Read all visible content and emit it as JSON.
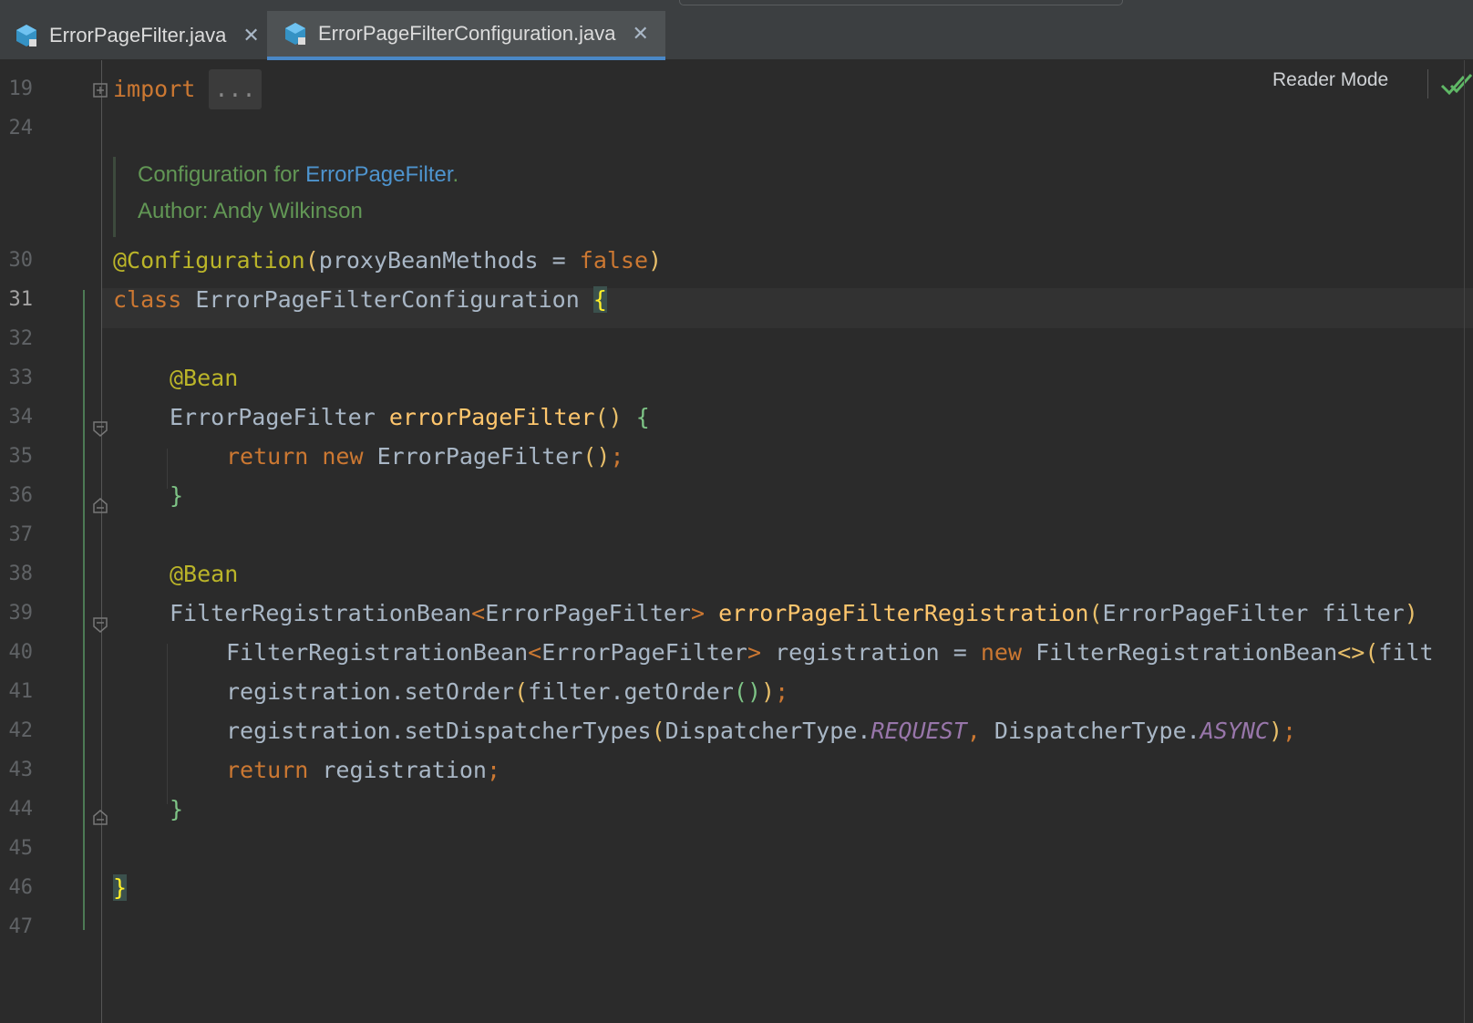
{
  "tabs": [
    {
      "label": "ErrorPageFilter.java",
      "active": false
    },
    {
      "label": "ErrorPageFilterConfiguration.java",
      "active": true
    }
  ],
  "reader_mode": "Reader Mode",
  "line_numbers": [
    "19",
    "24",
    "30",
    "31",
    "32",
    "33",
    "34",
    "35",
    "36",
    "37",
    "38",
    "39",
    "40",
    "41",
    "42",
    "43",
    "44",
    "45",
    "46",
    "47"
  ],
  "current_line": "31",
  "doc": {
    "prefix": "Configuration for ",
    "link": "ErrorPageFilter",
    "suffix": ".",
    "author": "Author: Andy Wilkinson"
  },
  "code": {
    "l19_kw": "import",
    "l19_fold": "...",
    "l30_ann": "@Configuration",
    "l30_open": "(",
    "l30_param": "proxyBeanMethods = ",
    "l30_false": "false",
    "l30_close": ")",
    "l31_kw": "class",
    "l31_name": " ErrorPageFilterConfiguration ",
    "l31_brace": "{",
    "l33_ann": "@Bean",
    "l34_type": "ErrorPageFilter ",
    "l34_fn": "errorPageFilter",
    "l34_parens": "()",
    "l34_brace": " {",
    "l35_return": "return",
    "l35_new": " new",
    "l35_type": " ErrorPageFilter",
    "l35_parens": "()",
    "l35_semi": ";",
    "l36_brace": "}",
    "l38_ann": "@Bean",
    "l39_type": "FilterRegistrationBean",
    "l39_lt": "<",
    "l39_generic": "ErrorPageFilter",
    "l39_gt": "> ",
    "l39_fn": "errorPageFilterRegistration",
    "l39_open": "(",
    "l39_params": "ErrorPageFilter filter",
    "l39_close": ")",
    "l40_type": "FilterRegistrationBean",
    "l40_lt": "<",
    "l40_generic": "ErrorPageFilter",
    "l40_gt": ">",
    "l40_var": " registration = ",
    "l40_new": "new",
    "l40_ctor": " FilterRegistrationBean",
    "l40_diamond": "<>(",
    "l40_rest": "filt",
    "l41_call": "registration.setOrder",
    "l41_open": "(",
    "l41_arg": "filter.getOrder",
    "l41_inner": "()",
    "l41_close": ")",
    "l41_semi": ";",
    "l42_call": "registration.setDispatcherTypes",
    "l42_open": "(",
    "l42_t1": "DispatcherType.",
    "l42_c1": "REQUEST",
    "l42_comma": ",",
    "l42_t2": " DispatcherType.",
    "l42_c2": "ASYNC",
    "l42_close": ")",
    "l42_semi": ";",
    "l43_return": "return",
    "l43_var": " registration",
    "l43_semi": ";",
    "l44_brace": "}",
    "l46_brace": "}"
  },
  "colors": {
    "background": "#2b2b2b",
    "keyword": "#cc7832",
    "annotation": "#bbb529",
    "function": "#ffc66d",
    "comment": "#629755",
    "active_tab_underline": "#4a88c7"
  }
}
